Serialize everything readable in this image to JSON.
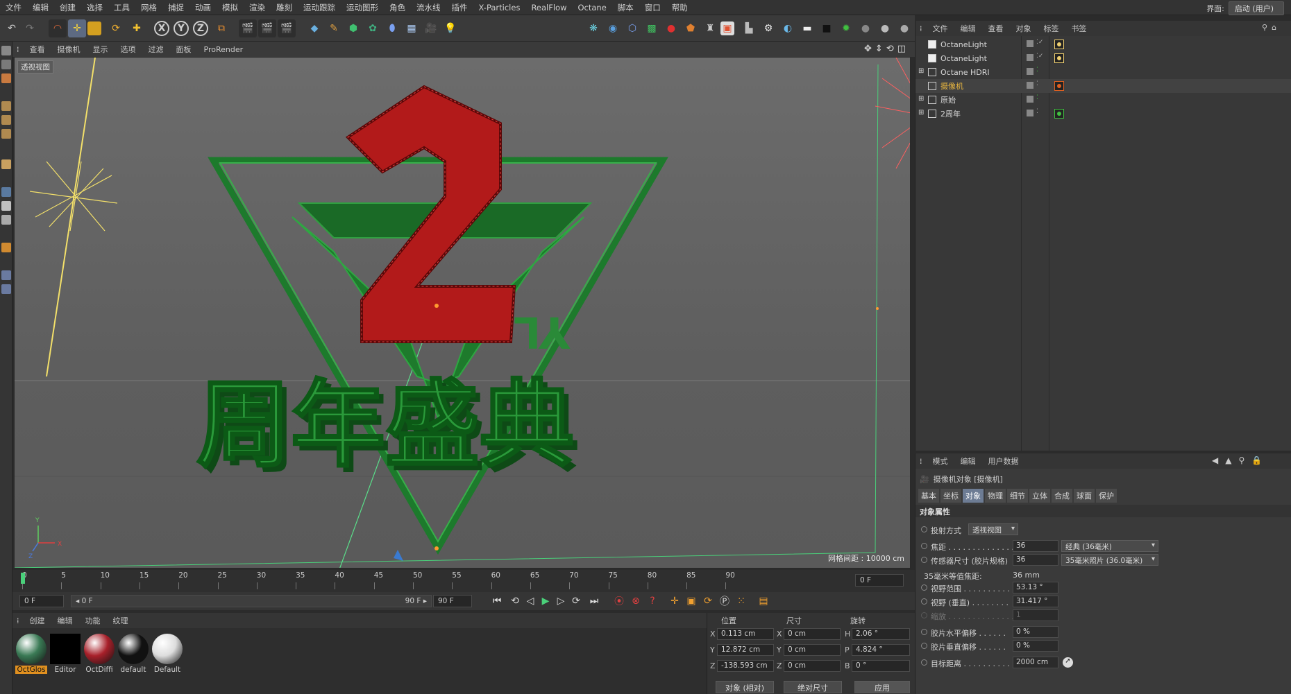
{
  "menu": [
    "文件",
    "编辑",
    "创建",
    "选择",
    "工具",
    "网格",
    "捕捉",
    "动画",
    "模拟",
    "渲染",
    "雕刻",
    "运动跟踪",
    "运动图形",
    "角色",
    "流水线",
    "插件",
    "X-Particles",
    "RealFlow",
    "Octane",
    "脚本",
    "窗口",
    "帮助"
  ],
  "layout": {
    "label": "界面:",
    "value": "启动 (用户)"
  },
  "toolbar": {
    "x": "X",
    "y": "Y",
    "z": "Z"
  },
  "viewport": {
    "menu": [
      "查看",
      "摄像机",
      "显示",
      "选项",
      "过滤",
      "面板",
      "ProRender"
    ],
    "label": "透视视图",
    "grid_info": "网格间距 : 10000 cm",
    "axis": {
      "x": "X",
      "y": "Y",
      "z": "Z"
    },
    "title_text": "周年盛典",
    "sub_text": "2周年"
  },
  "timeline": {
    "ticks": [
      "0",
      "5",
      "10",
      "15",
      "20",
      "25",
      "30",
      "35",
      "40",
      "45",
      "50",
      "55",
      "60",
      "65",
      "70",
      "75",
      "80",
      "85",
      "90"
    ],
    "frame_right": "0 F",
    "start": "0 F",
    "range_start": "◂ 0 F",
    "range_end": "90 F ▸",
    "end": "90 F"
  },
  "materials": {
    "menu": [
      "创建",
      "编辑",
      "功能",
      "纹理"
    ],
    "items": [
      {
        "label": "OctGlos",
        "color": "#3a7a55"
      },
      {
        "label": "Editor",
        "color": "#000000"
      },
      {
        "label": "OctDiffi",
        "color": "#a8202a"
      },
      {
        "label": "default",
        "color": "#111111"
      },
      {
        "label": "Default",
        "color": "#dddddd"
      }
    ]
  },
  "coords": {
    "headers": [
      "位置",
      "尺寸",
      "旋转"
    ],
    "rows": [
      {
        "a": "X",
        "av": "0.113 cm",
        "b": "X",
        "bv": "0 cm",
        "c": "H",
        "cv": "2.06 °"
      },
      {
        "a": "Y",
        "av": "12.872 cm",
        "b": "Y",
        "bv": "0 cm",
        "c": "P",
        "cv": "4.824 °"
      },
      {
        "a": "Z",
        "av": "-138.593 cm",
        "b": "Z",
        "bv": "0 cm",
        "c": "B",
        "cv": "0 °"
      }
    ],
    "mode1": "对象 (相对)",
    "mode2": "绝对尺寸",
    "apply": "应用"
  },
  "objects": {
    "menu": [
      "文件",
      "编辑",
      "查看",
      "对象",
      "标签",
      "书签"
    ],
    "items": [
      {
        "name": "OctaneLight",
        "color": "#d8d8d8"
      },
      {
        "name": "OctaneLight",
        "color": "#d8d8d8"
      },
      {
        "name": "Octane HDRI",
        "color": "#d8d8d8"
      },
      {
        "name": "摄像机",
        "color": "#e8b640"
      },
      {
        "name": "原始",
        "color": "#d8d8d8"
      },
      {
        "name": "2周年",
        "color": "#d8d8d8"
      }
    ]
  },
  "attributes": {
    "menu": [
      "模式",
      "编辑",
      "用户数据"
    ],
    "object_title": "摄像机对象 [摄像机]",
    "tabs": [
      "基本",
      "坐标",
      "对象",
      "物理",
      "细节",
      "立体",
      "合成",
      "球面",
      "保护"
    ],
    "active_tab": "对象",
    "section": "对象属性",
    "projection_label": "投射方式",
    "projection_value": "透视视图",
    "rows": [
      {
        "label": "焦距 . . . . . . . . . . . . . .",
        "value": "36",
        "drop": "经典 (36毫米)"
      },
      {
        "label": "传感器尺寸 (胶片规格)",
        "value": "36",
        "drop": "35毫米照片 (36.0毫米)"
      },
      {
        "label": "35毫米等值焦距:",
        "text": "36 mm"
      },
      {
        "label": "视野范围 . . . . . . . . . .",
        "value": "53.13 °"
      },
      {
        "label": "视野 (垂直) . . . . . . . .",
        "value": "31.417 °"
      },
      {
        "label": "缩放 . . . . . . . . . . . . . .",
        "value": "1"
      },
      {
        "label": "胶片水平偏移 . . . . . .",
        "value": "0 %"
      },
      {
        "label": "胶片垂直偏移 . . . . . .",
        "value": "0 %"
      },
      {
        "label": "目标距离 . . . . . . . . . .",
        "value": "2000 cm"
      }
    ]
  }
}
